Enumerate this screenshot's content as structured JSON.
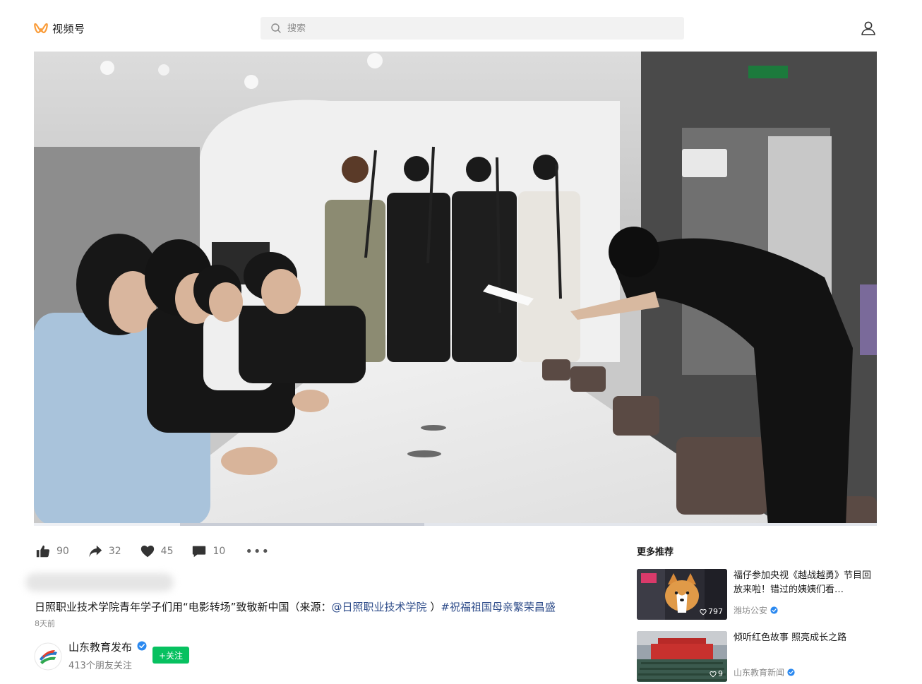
{
  "app": {
    "name": "视频号"
  },
  "search": {
    "placeholder": "搜索",
    "value": ""
  },
  "video": {
    "progress_played": 0.173,
    "progress_buffered": 0.463
  },
  "actions": {
    "like_count": "90",
    "share_count": "32",
    "heart_count": "45",
    "comment_count": "10",
    "more_label": "•••"
  },
  "post": {
    "desc_main": "日照职业技术学院青年学子们用“电影转场”致敬新中国（来源：",
    "desc_mention": "@日照职业技术学院",
    "desc_sep": " ）",
    "desc_tag": "#祝福祖国母亲繁荣昌盛",
    "time": "8天前"
  },
  "author": {
    "name": "山东教育发布",
    "friends_following": "413个朋友关注",
    "follow_label": "+关注"
  },
  "recommendations": {
    "title": "更多推荐",
    "items": [
      {
        "title": "福仔参加央视《越战越勇》节目回放来啦！错过的姨姨们看…",
        "source": "潍坊公安",
        "likes": "797"
      },
      {
        "title": "倾听红色故事 照亮成长之路",
        "source": "山东教育新闻",
        "likes": "9"
      }
    ]
  },
  "colors": {
    "follow_green": "#07c160",
    "verified_blue": "#2b89f0",
    "logo_orange": "#fa9d3b"
  }
}
